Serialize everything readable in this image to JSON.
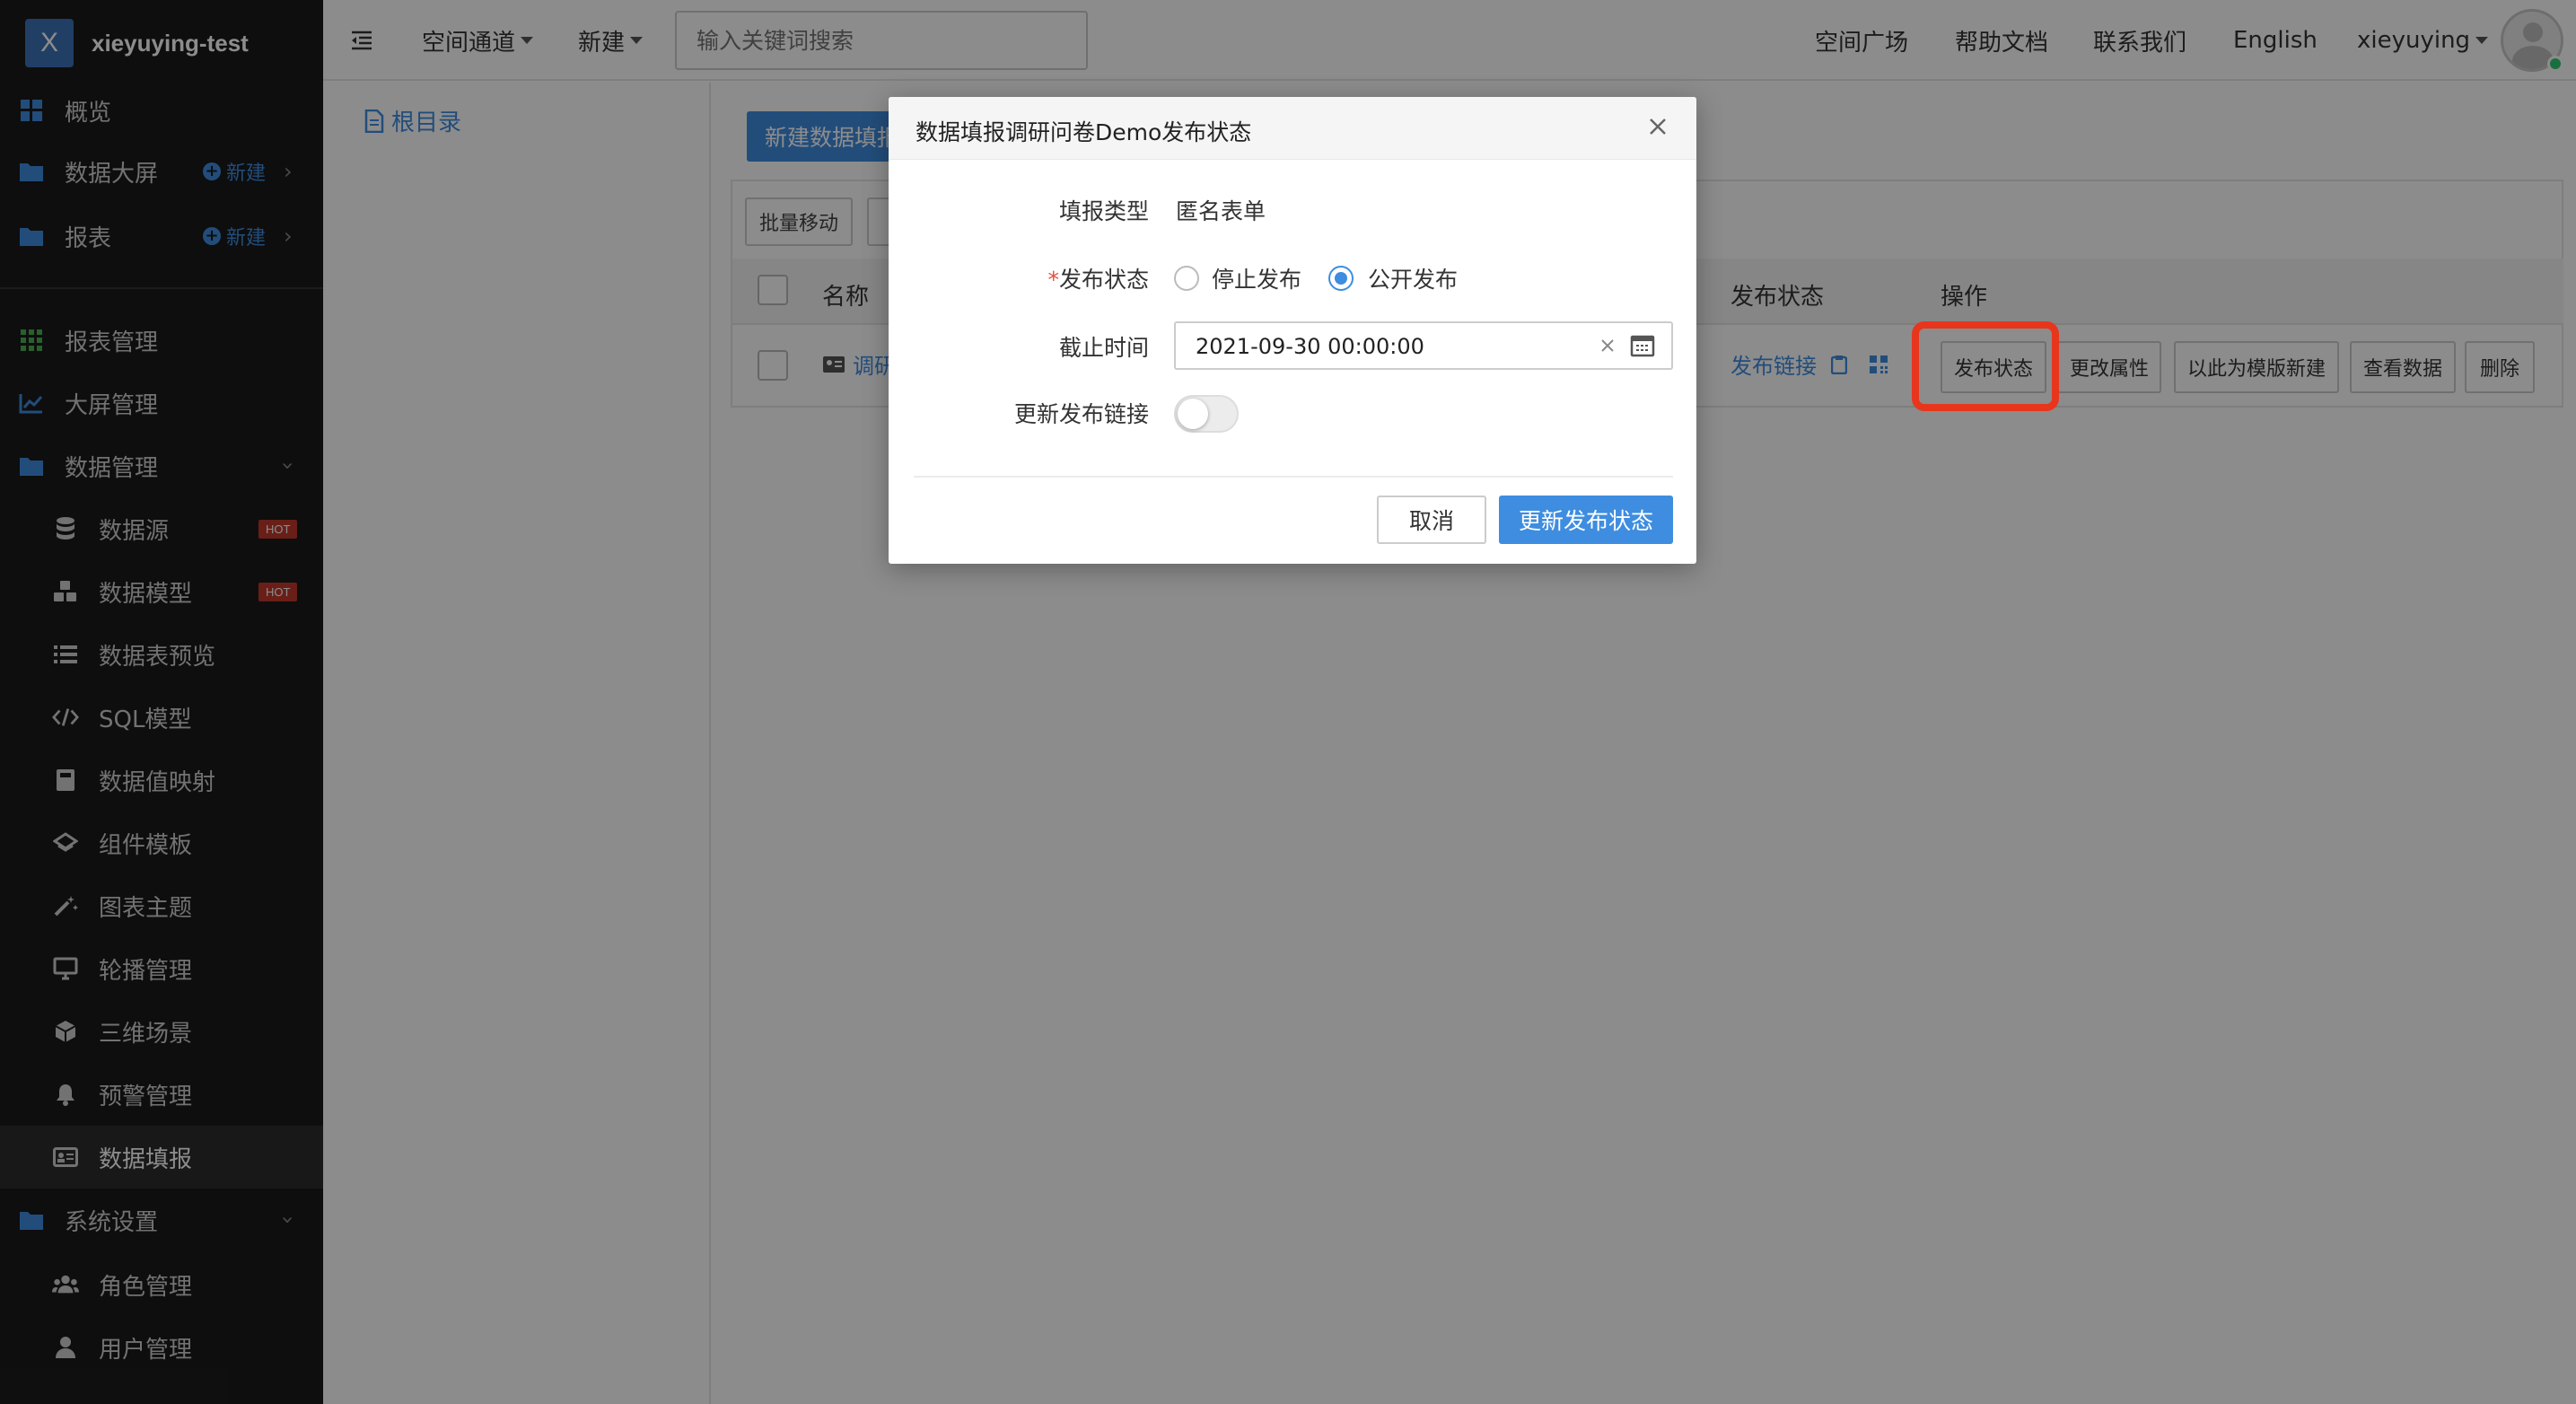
{
  "brand": {
    "logo_letter": "X",
    "name": "xieyuying-test"
  },
  "sidebar": {
    "items": [
      {
        "label": "概览",
        "icon": "dashboard-icon"
      },
      {
        "label": "数据大屏",
        "icon": "folder-icon",
        "new_label": "新建"
      },
      {
        "label": "报表",
        "icon": "folder-icon",
        "new_label": "新建"
      },
      {
        "label": "报表管理",
        "icon": "grid-icon"
      },
      {
        "label": "大屏管理",
        "icon": "chart-line-icon"
      },
      {
        "label": "数据管理",
        "icon": "folder-icon"
      },
      {
        "label": "数据源",
        "icon": "database-icon",
        "badge": "HOT"
      },
      {
        "label": "数据模型",
        "icon": "cubes-icon",
        "badge": "HOT"
      },
      {
        "label": "数据表预览",
        "icon": "list-icon"
      },
      {
        "label": "SQL模型",
        "icon": "code-icon"
      },
      {
        "label": "数据值映射",
        "icon": "book-icon"
      },
      {
        "label": "组件模板",
        "icon": "layers-icon"
      },
      {
        "label": "图表主题",
        "icon": "magic-wand-icon"
      },
      {
        "label": "轮播管理",
        "icon": "monitor-icon"
      },
      {
        "label": "三维场景",
        "icon": "cube-icon"
      },
      {
        "label": "预警管理",
        "icon": "bell-icon"
      },
      {
        "label": "数据填报",
        "icon": "id-card-icon"
      },
      {
        "label": "系统设置",
        "icon": "folder-icon"
      },
      {
        "label": "角色管理",
        "icon": "users-icon"
      },
      {
        "label": "用户管理",
        "icon": "user-icon"
      }
    ]
  },
  "topbar": {
    "space_channel": "空间通道",
    "new": "新建",
    "search_placeholder": "输入关键词搜索",
    "links": [
      "空间广场",
      "帮助文档",
      "联系我们",
      "English"
    ],
    "username": "xieyuying"
  },
  "tree": {
    "root_label": "根目录"
  },
  "main": {
    "new_button_partial": "新建数据填报",
    "batch_move": "批量移动",
    "table": {
      "headers": {
        "name": "名称",
        "publish_status": "发布状态",
        "actions": "操作"
      },
      "row": {
        "name_partial": "调研",
        "publish_link": "发布链接",
        "actions": [
          "发布状态",
          "更改属性",
          "以此为模版新建",
          "查看数据",
          "删除"
        ]
      }
    }
  },
  "modal": {
    "title": "数据填报调研问卷Demo发布状态",
    "fill_type_label": "填报类型",
    "fill_type_value": "匿名表单",
    "publish_status_label": "发布状态",
    "options": [
      "停止发布",
      "公开发布"
    ],
    "selected_option": "公开发布",
    "deadline_label": "截止时间",
    "deadline_value": "2021-09-30 00:00:00",
    "refresh_link_label": "更新发布链接",
    "refresh_link_on": false,
    "cancel": "取消",
    "submit": "更新发布状态"
  },
  "colors": {
    "accent": "#3e8de0",
    "sidebar_bg": "#1b1b1b",
    "highlight": "#e8361c",
    "hot_badge": "#c0392b"
  }
}
